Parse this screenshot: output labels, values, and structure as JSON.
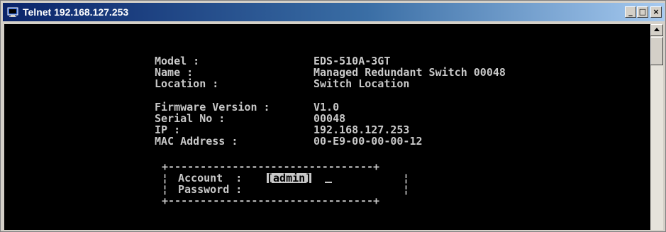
{
  "window": {
    "title": "Telnet 192.168.127.253",
    "app_icon": "telnet-icon",
    "buttons": {
      "minimize": "_",
      "maximize": "□",
      "close": "×"
    }
  },
  "device_info": {
    "model_label": "Model :",
    "model_value": "EDS-510A-3GT",
    "name_label": "Name :",
    "name_value": "Managed Redundant Switch 00048",
    "location_label": "Location :",
    "location_value": "Switch Location",
    "firmware_label": "Firmware Version :",
    "firmware_value": "V1.0",
    "serial_label": "Serial No :",
    "serial_value": "00048",
    "ip_label": "IP :",
    "ip_value": "192.168.127.253",
    "mac_label": "MAC Address :",
    "mac_value": "00-E9-00-00-00-12"
  },
  "login": {
    "border_top": "+--------------------------------+",
    "border_bottom": "+--------------------------------+",
    "account_label": "Account  :",
    "account_value": "[admin]",
    "password_label": "Password :",
    "password_value": ""
  },
  "colors": {
    "terminal_bg": "#000000",
    "terminal_fg": "#c8c8c8",
    "titlebar_start": "#0a246a",
    "titlebar_end": "#a6caf0"
  }
}
